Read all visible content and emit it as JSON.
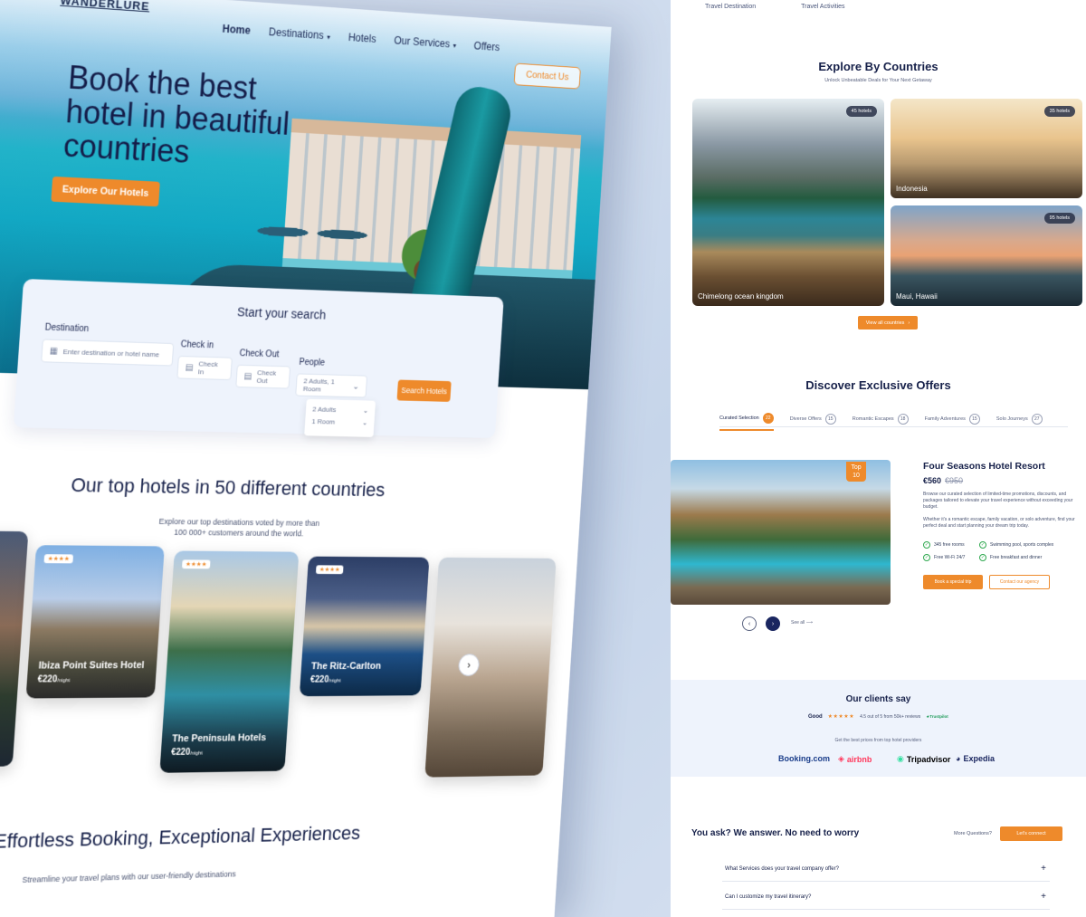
{
  "left": {
    "logo": "WANDERLURE",
    "nav": {
      "home": "Home",
      "destinations": "Destinations",
      "hotels": "Hotels",
      "services": "Our Services",
      "offers": "Offers",
      "contact": "Contact Us"
    },
    "hero": {
      "title": "Book the best hotel in beautiful countries",
      "cta": "Explore Our Hotels"
    },
    "search": {
      "title": "Start your search",
      "destination_label": "Destination",
      "destination_placeholder": "Enter destination or hotel name",
      "checkin_label": "Check in",
      "checkin_placeholder": "Check In",
      "checkout_label": "Check Out",
      "checkout_placeholder": "Check Out",
      "people_label": "People",
      "people_value": "2 Adults, 1 Room",
      "people_option_adults": "2 Adults",
      "people_option_room": "1 Room",
      "button": "Search Hotels"
    },
    "top_hotels": {
      "title": "Our top hotels in 50 different countries",
      "subtitle": "Explore our top destinations voted by more than 100 000+ customers around the world.",
      "cards": [
        {
          "name": "Ibiza Point Suites Hotel",
          "price": "€220",
          "per": "/night",
          "stars": "★★★★"
        },
        {
          "name": "The Peninsula Hotels",
          "price": "€220",
          "per": "/night",
          "stars": "★★★★"
        },
        {
          "name": "The Ritz-Carlton",
          "price": "€220",
          "per": "/night",
          "stars": "★★★★"
        }
      ]
    },
    "effortless": {
      "title": "Effortless Booking, Exceptional Experiences",
      "subtitle": "Streamline your travel plans with our user-friendly destinations"
    }
  },
  "right": {
    "top_tabs": [
      "Travel Destination",
      "Travel Activities"
    ],
    "countries": {
      "title": "Explore By Countries",
      "subtitle": "Unlock Unbeatable Deals for Your Next Getaway",
      "items": [
        {
          "name": "Chimelong ocean kingdom",
          "count": "45 hotels"
        },
        {
          "name": "Indonesia",
          "count": "35 hotels"
        },
        {
          "name": "Maui, Hawaii",
          "count": "95 hotels"
        }
      ],
      "view_all": "View all countries"
    },
    "offers": {
      "title": "Discover Exclusive Offers",
      "tabs": [
        {
          "label": "Curated Selection",
          "count": "22"
        },
        {
          "label": "Diverse Offers",
          "count": "15"
        },
        {
          "label": "Romantic Escapes",
          "count": "18"
        },
        {
          "label": "Family Adventures",
          "count": "15"
        },
        {
          "label": "Solo Journeys",
          "count": "27"
        }
      ],
      "badge_top": "Top",
      "badge_num": "10",
      "name": "Four Seasons Hotel Resort",
      "price": "€560",
      "old_price": "€950",
      "desc1": "Browse our curated selection of limited-time promotions, discounts, and packages tailored to elevate your travel experience without exceeding your budget.",
      "desc2": "Whether it's a romantic escape, family vacation, or solo adventure, find your perfect deal and start planning your dream trip today.",
      "features": [
        "345 free rooms",
        "Swimming pool, sports complex",
        "Free Wi-Fi 24/7",
        "Free breakfast and dinner"
      ],
      "book": "Book a special trip",
      "contact": "Contact our agency",
      "see_all": "See all"
    },
    "clients": {
      "title": "Our clients say",
      "good": "Good",
      "stars": "★★★★★",
      "score": "4.5 out of 5 from 50k+ reviews",
      "trustpilot": "Trustpilot",
      "best": "Get the best prices from top hotel providers",
      "brands": [
        "Booking.com",
        "airbnb",
        "Tripadvisor",
        "Expedia"
      ]
    },
    "faq": {
      "title": "You ask? We answer. No need to worry",
      "more": "More Questions?",
      "connect": "Let's connect",
      "items": [
        "What Services does your travel company offer?",
        "Can I customize my travel itinerary?"
      ]
    },
    "colors": {
      "accent": "#ee8a2b",
      "navy": "#17214a",
      "success": "#2ea84e"
    }
  }
}
